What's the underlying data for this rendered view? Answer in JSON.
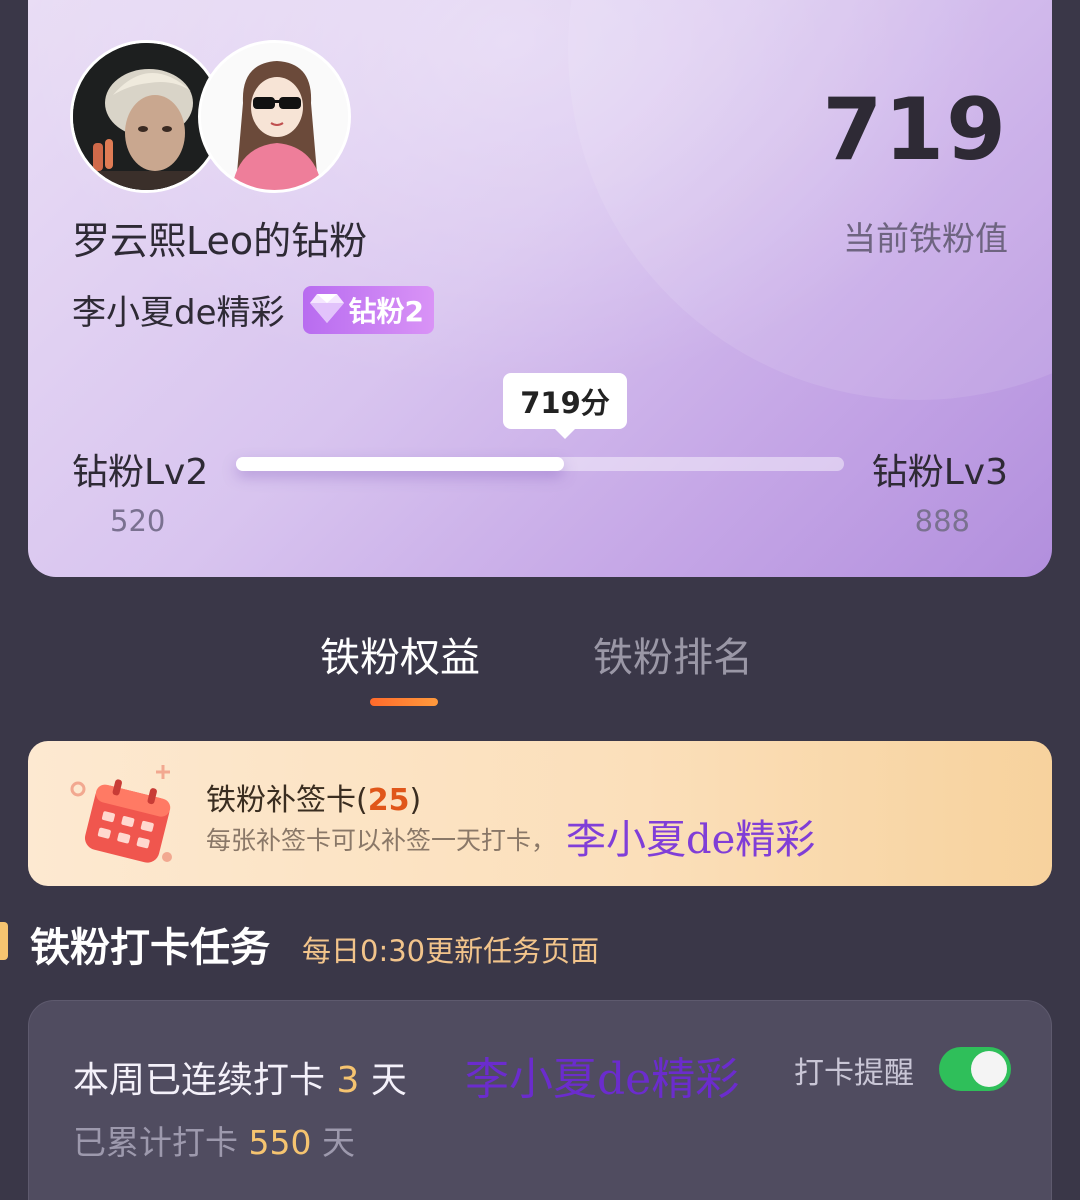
{
  "fan_card": {
    "title": "罗云熙Leo的钻粉",
    "user_name": "李小夏de精彩",
    "level_badge": "钻粉2",
    "score": "719",
    "score_caption": "当前铁粉值",
    "progress": {
      "bubble": "719分",
      "left_level": "钻粉Lv2",
      "left_value": "520",
      "right_level": "钻粉Lv3",
      "right_value": "888",
      "fill_fraction": 0.54
    },
    "icons": [
      "idol-avatar",
      "user-avatar",
      "diamond-icon"
    ]
  },
  "tabs": [
    {
      "label": "铁粉权益",
      "active": true
    },
    {
      "label": "铁粉排名",
      "active": false
    }
  ],
  "makeup_card": {
    "title": "铁粉补签卡",
    "count_open": "(",
    "count": "25",
    "count_close": ")",
    "description": "每张补签卡可以补签一天打卡，",
    "watermark": "李小夏de精彩"
  },
  "checkin_section": {
    "title": "铁粉打卡任务",
    "subtitle": "每日0:30更新任务页面"
  },
  "checkin_card": {
    "streak_prefix": "本周已连续打卡",
    "streak_days": "3",
    "streak_suffix": "天",
    "total_prefix": "已累计打卡",
    "total_days": "550",
    "total_suffix": "天",
    "watermark": "李小夏de精彩",
    "reminder_label": "打卡提醒",
    "reminder_on": true
  },
  "colors": {
    "accent_orange": "#ff6a2b",
    "highlight_gold": "#f6c470",
    "toggle_green": "#2fbf5a",
    "watermark_purple": "#6e28dc"
  }
}
